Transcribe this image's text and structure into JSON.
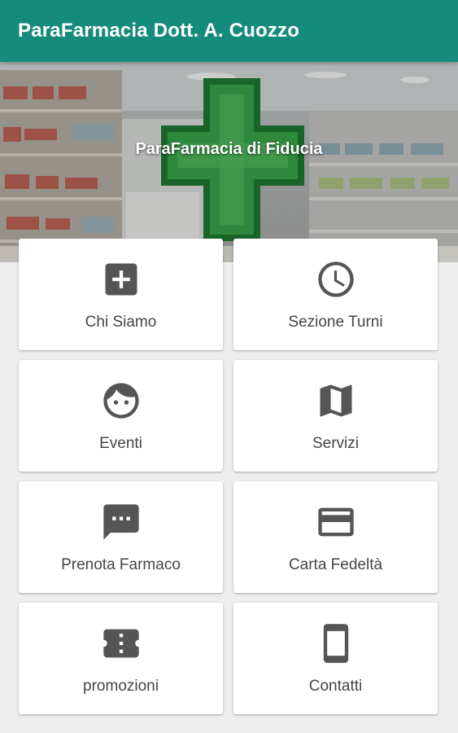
{
  "header": {
    "title": "ParaFarmacia Dott. A. Cuozzo",
    "background_color": "#158b7b"
  },
  "hero": {
    "tagline": "ParaFarmacia di Fiducia",
    "image": "pharmacy-interior-green-cross"
  },
  "menu": {
    "icon_color": "#555555",
    "items": [
      {
        "label": "Chi Siamo",
        "icon": "plus-box-icon"
      },
      {
        "label": "Sezione Turni",
        "icon": "clock-icon"
      },
      {
        "label": "Eventi",
        "icon": "face-icon"
      },
      {
        "label": "Servizi",
        "icon": "map-icon"
      },
      {
        "label": "Prenota Farmaco",
        "icon": "chat-bubble-icon"
      },
      {
        "label": "Carta Fedeltà",
        "icon": "credit-card-icon"
      },
      {
        "label": "promozioni",
        "icon": "ticket-icon"
      },
      {
        "label": "Contatti",
        "icon": "smartphone-icon"
      }
    ]
  }
}
